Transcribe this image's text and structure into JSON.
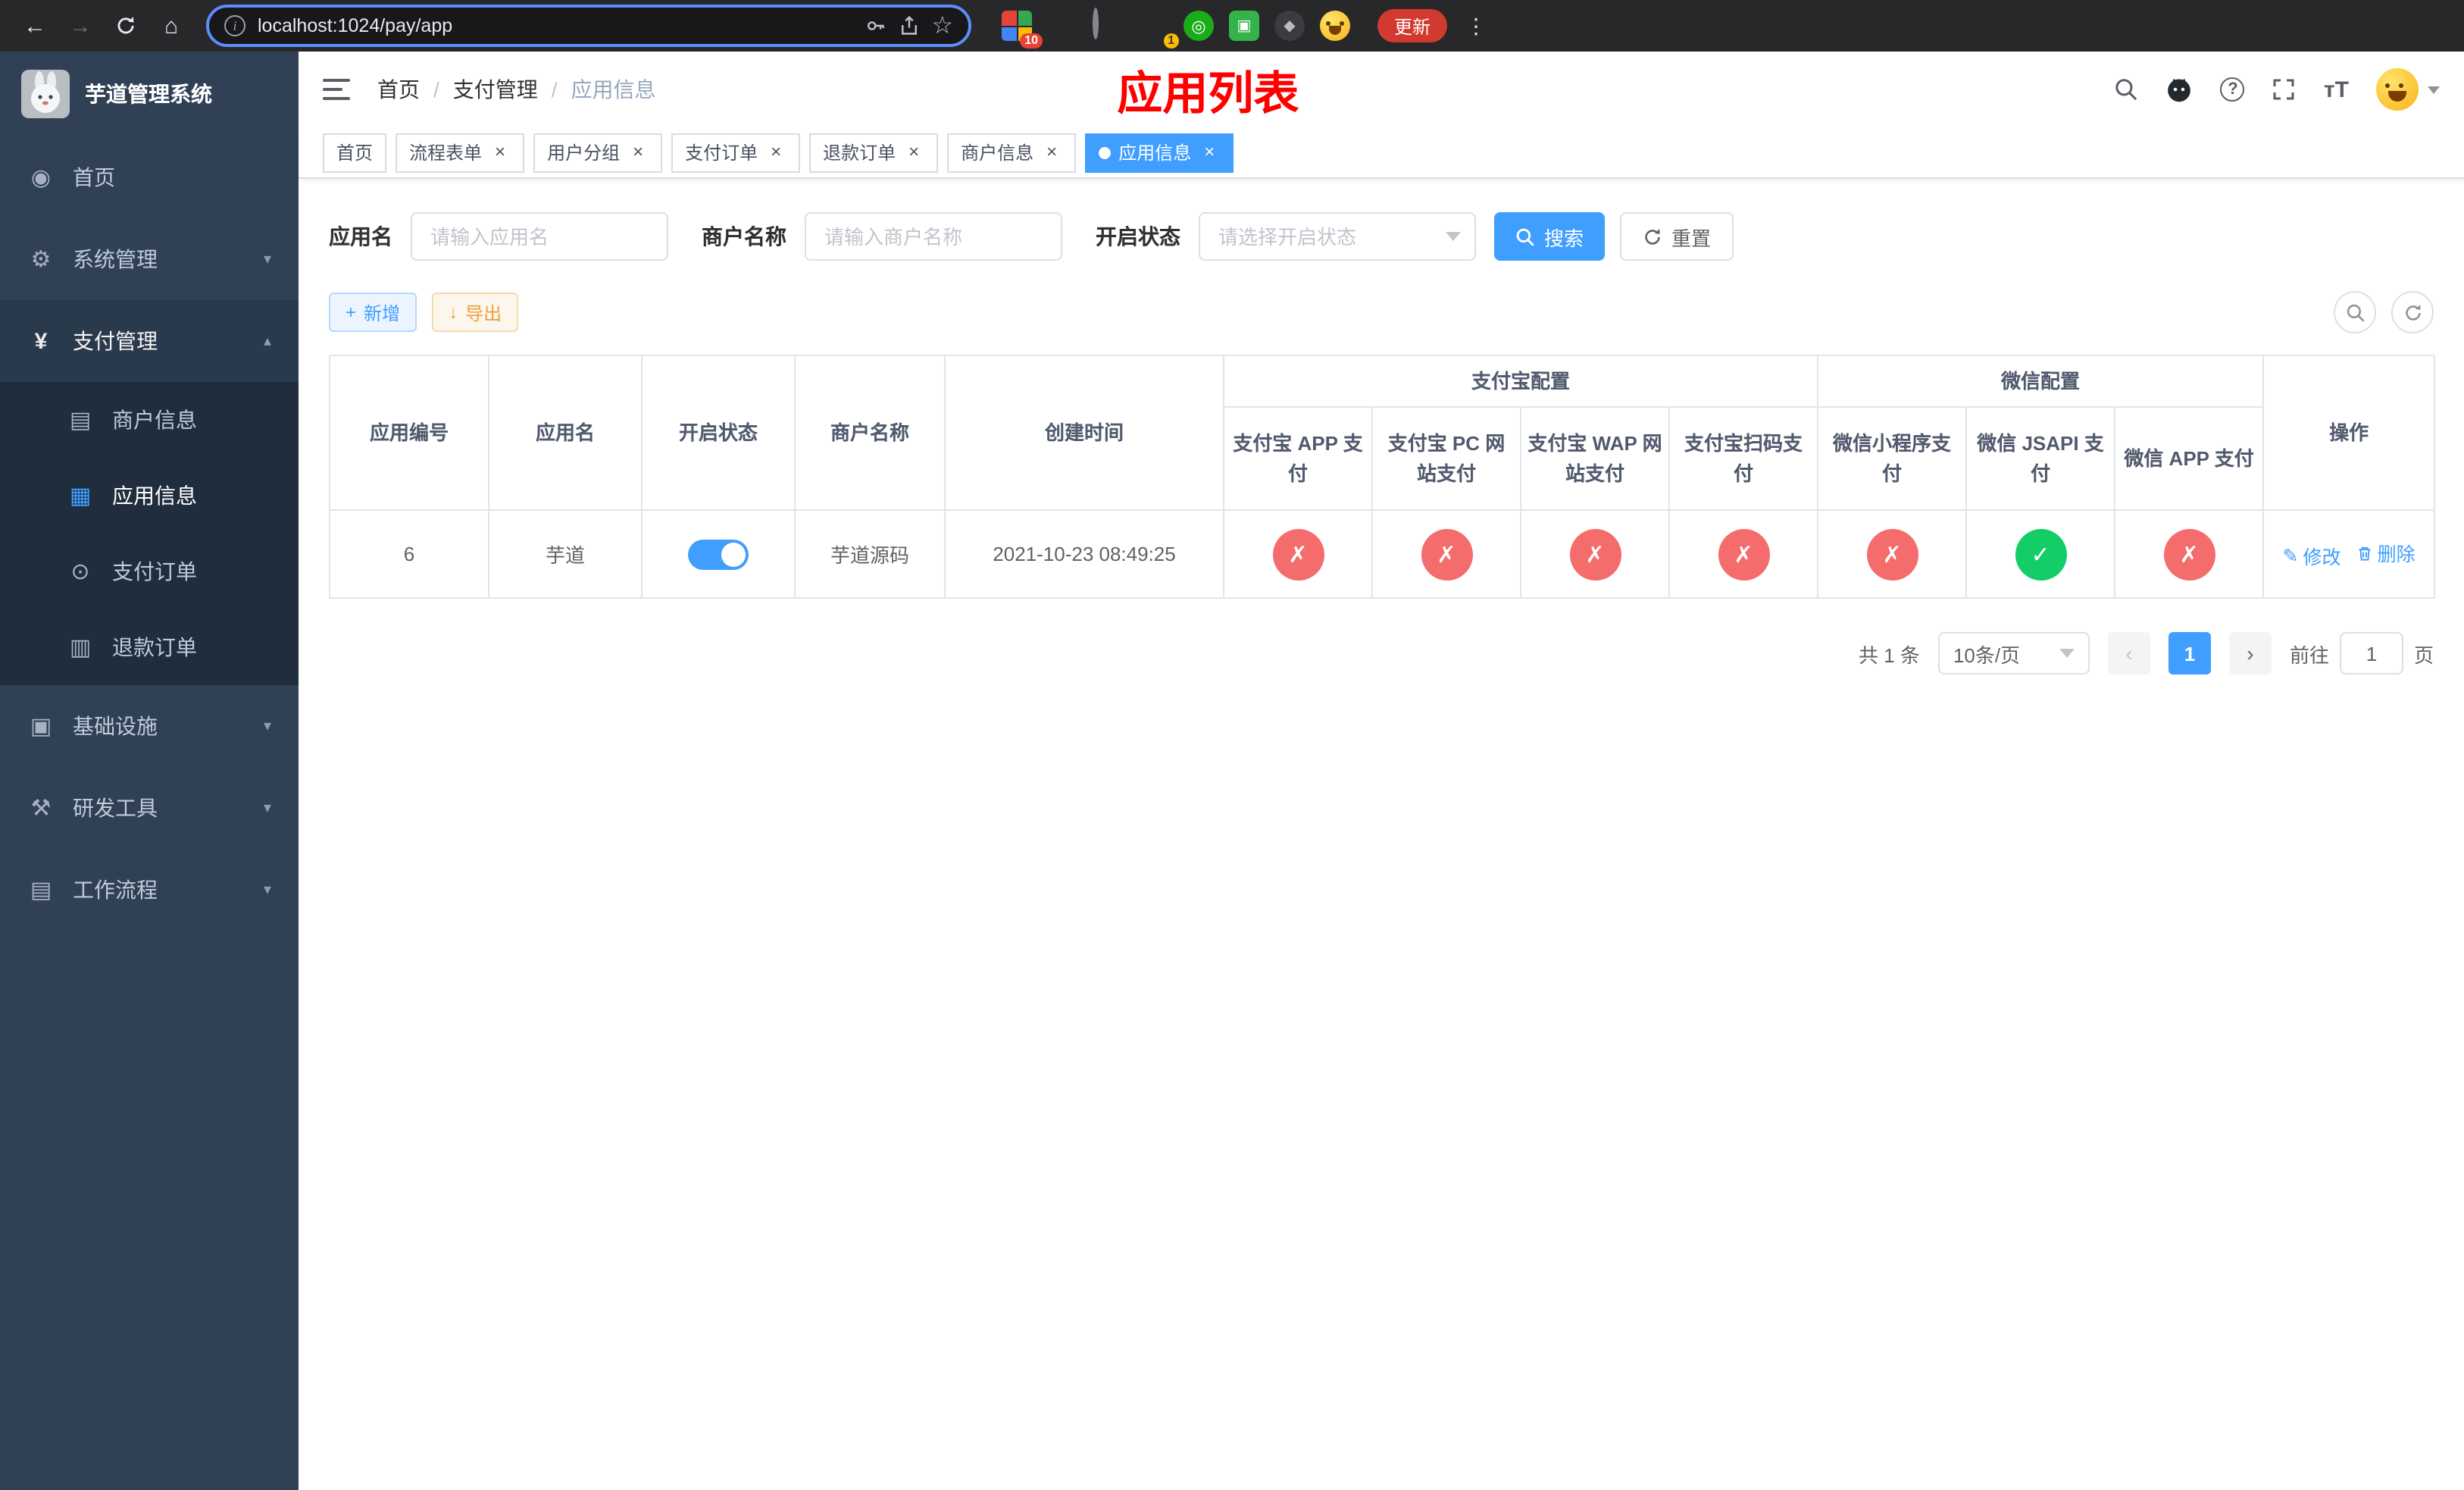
{
  "colors": {
    "primary": "#409eff",
    "danger": "#f56c6c",
    "success": "#13ce66",
    "warning": "#e6a23c",
    "title_red": "#ff0000",
    "sidebar_bg": "#304156",
    "submenu_bg": "#1f2d3d",
    "sidebar_text": "#bfcbd9",
    "tab_border": "#d8dce5",
    "update_red": "#d33a2f"
  },
  "icons": {
    "back": "←",
    "forward": "→",
    "home": "⌂",
    "star": "☆",
    "more": "⋮",
    "dashboard": "◉",
    "gear": "⚙",
    "yen": "¥",
    "card": "▤",
    "grid": "▦",
    "order": "⊙",
    "refund": "▥",
    "infra": "▣",
    "tools": "⚒",
    "workflow": "▤",
    "chevron_down": "▾",
    "chevron_up": "▴",
    "plus": "+",
    "download": "↓",
    "close": "×",
    "edit": "✎",
    "check": "✓",
    "cross": "✗",
    "prev": "‹",
    "next": "›",
    "slash": "/",
    "info": "i",
    "question": "?"
  },
  "browser": {
    "url": "localhost:1024/pay/app",
    "update_label": "更新",
    "ext_badge_grid": "10",
    "ext_badge_avatar": "1"
  },
  "sidebar": {
    "title": "芋道管理系统",
    "items": {
      "home": "首页",
      "system": "系统管理",
      "pay": "支付管理",
      "infra": "基础设施",
      "devtools": "研发工具",
      "workflow": "工作流程"
    },
    "pay_children": {
      "merchant": "商户信息",
      "app": "应用信息",
      "order": "支付订单",
      "refund": "退款订单"
    }
  },
  "navbar": {
    "breadcrumb": [
      "首页",
      "支付管理",
      "应用信息"
    ],
    "page_title": "应用列表",
    "font_size_icon": "тT"
  },
  "tabs": [
    {
      "label": "首页"
    },
    {
      "label": "流程表单"
    },
    {
      "label": "用户分组"
    },
    {
      "label": "支付订单"
    },
    {
      "label": "退款订单"
    },
    {
      "label": "商户信息"
    },
    {
      "label": "应用信息"
    }
  ],
  "filter": {
    "app_name_label": "应用名",
    "app_name_placeholder": "请输入应用名",
    "merchant_label": "商户名称",
    "merchant_placeholder": "请输入商户名称",
    "status_label": "开启状态",
    "status_placeholder": "请选择开启状态",
    "search_label": "搜索",
    "reset_label": "重置"
  },
  "toolbar": {
    "add_label": "新增",
    "export_label": "导出"
  },
  "table": {
    "headers": {
      "app_id": "应用编号",
      "app_name": "应用名",
      "status": "开启状态",
      "merchant": "商户名称",
      "created": "创建时间",
      "alipay_group": "支付宝配置",
      "wechat_group": "微信配置",
      "alipay_app": "支付宝 APP 支付",
      "alipay_pc": "支付宝 PC 网站支付",
      "alipay_wap": "支付宝 WAP 网站支付",
      "alipay_qr": "支付宝扫码支付",
      "wechat_lite": "微信小程序支付",
      "wechat_jsapi": "微信 JSAPI 支付",
      "wechat_app": "微信 APP 支付",
      "actions": "操作"
    },
    "rows": [
      {
        "app_id": "6",
        "app_name": "芋道",
        "status_on": true,
        "merchant": "芋道源码",
        "created": "2021-10-23 08:49:25",
        "configs": {
          "alipay_app": false,
          "alipay_pc": false,
          "alipay_wap": false,
          "alipay_qr": false,
          "wechat_lite": false,
          "wechat_jsapi": true,
          "wechat_app": false
        },
        "edit_label": "修改",
        "delete_label": "删除"
      }
    ]
  },
  "pagination": {
    "total_text": "共 1 条",
    "page_size": "10条/页",
    "current_page": "1",
    "goto_label": "前往",
    "goto_value": "1",
    "goto_suffix": "页"
  }
}
